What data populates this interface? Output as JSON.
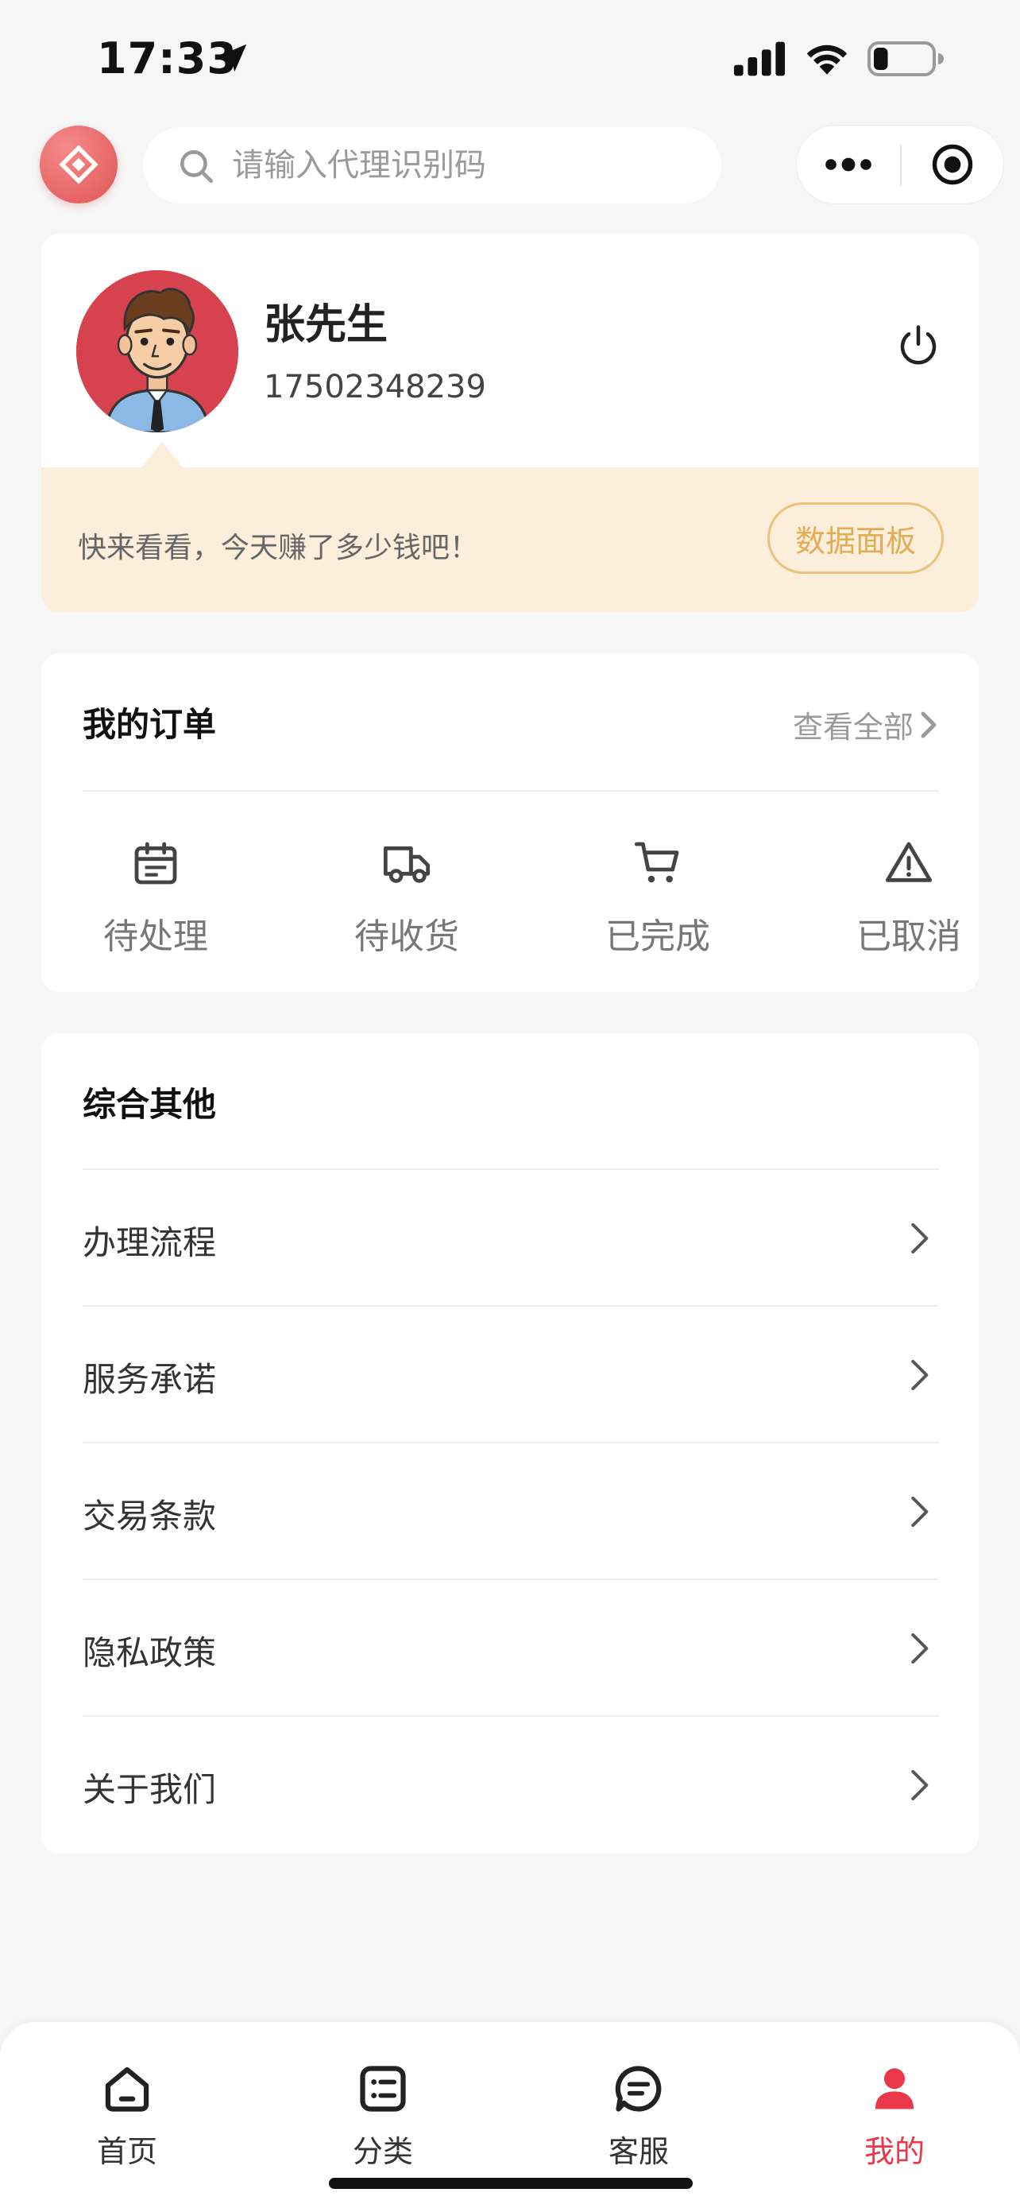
{
  "status_bar": {
    "time": "17:33",
    "battery_level": 0.25
  },
  "search": {
    "placeholder": "请输入代理识别码"
  },
  "profile": {
    "name": "张先生",
    "phone": "17502348239",
    "promo_text": "快来看看，今天赚了多少钱吧！",
    "dashboard_label": "数据面板"
  },
  "orders": {
    "title": "我的订单",
    "view_all": "查看全部",
    "items": [
      {
        "label": "待处理",
        "icon": "calendar-icon"
      },
      {
        "label": "待收货",
        "icon": "truck-icon"
      },
      {
        "label": "已完成",
        "icon": "cart-icon"
      },
      {
        "label": "已取消",
        "icon": "warning-icon"
      }
    ]
  },
  "others": {
    "title": "综合其他",
    "items": [
      {
        "label": "办理流程"
      },
      {
        "label": "服务承诺"
      },
      {
        "label": "交易条款"
      },
      {
        "label": "隐私政策"
      },
      {
        "label": "关于我们"
      }
    ]
  },
  "tabbar": {
    "active": 3,
    "active_color": "#e8384a",
    "items": [
      {
        "label": "首页",
        "icon": "home-icon"
      },
      {
        "label": "分类",
        "icon": "list-icon"
      },
      {
        "label": "客服",
        "icon": "chat-icon"
      },
      {
        "label": "我的",
        "icon": "user-icon"
      }
    ]
  }
}
